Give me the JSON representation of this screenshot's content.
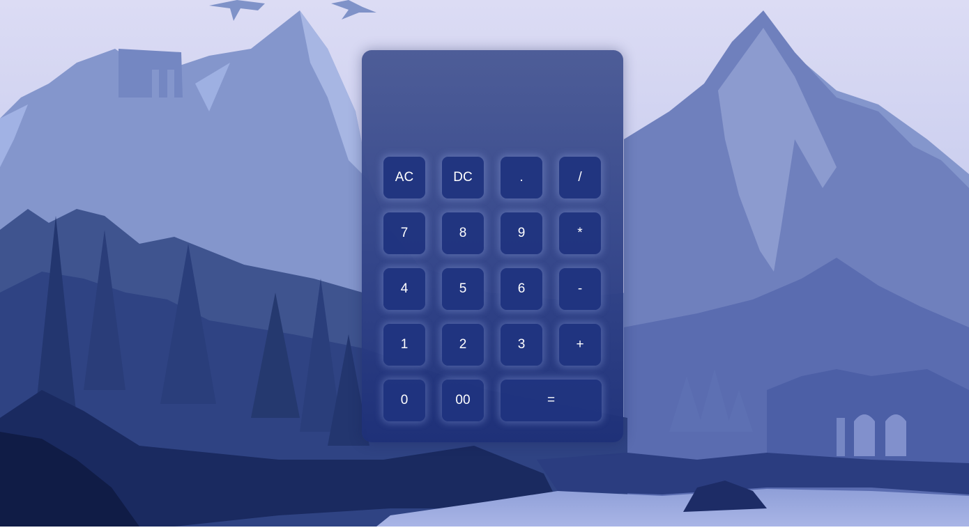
{
  "calculator": {
    "display_value": "",
    "keys": {
      "ac": "AC",
      "dc": "DC",
      "dot": ".",
      "divide": "/",
      "seven": "7",
      "eight": "8",
      "nine": "9",
      "multiply": "*",
      "four": "4",
      "five": "5",
      "six": "6",
      "minus": "-",
      "one": "1",
      "two": "2",
      "three": "3",
      "plus": "+",
      "zero": "0",
      "double_zero": "00",
      "equals": "="
    }
  },
  "colors": {
    "key_background": "#22357f",
    "panel_top": "#48589a",
    "panel_bottom": "#1e3078",
    "sky": "#d6d8f2"
  }
}
